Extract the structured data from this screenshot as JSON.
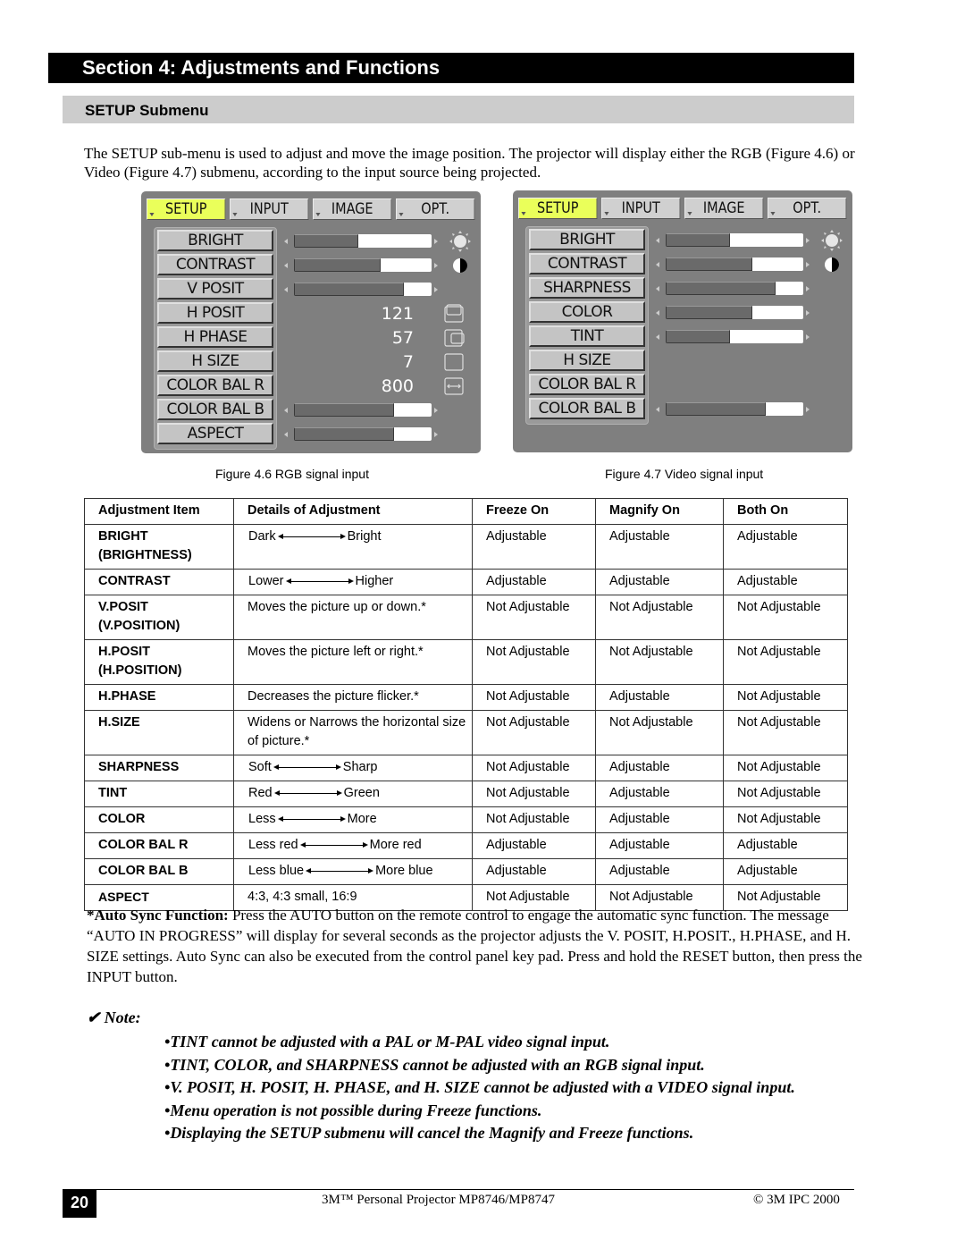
{
  "header": {
    "section_title": "Section 4: Adjustments and Functions",
    "subsection_title": "SETUP Submenu"
  },
  "intro": "The SETUP sub-menu is used to adjust and move the image position. The projector will display either the RGB (Figure 4.6) or Video (Figure 4.7) submenu, according to the input source being projected.",
  "osd_rgb": {
    "caption": "Figure 4.6 RGB signal input",
    "tabs": [
      "SETUP",
      "INPUT",
      "IMAGE",
      "OPT."
    ],
    "active_tab": "SETUP",
    "items": [
      {
        "label": "BRIGHT",
        "type": "slider",
        "level_percent": 47,
        "icon": "sun-icon"
      },
      {
        "label": "CONTRAST",
        "type": "slider",
        "level_percent": 63,
        "icon": "contrast-icon"
      },
      {
        "label": "V POSIT",
        "type": "slider",
        "level_percent": 80,
        "icon": ""
      },
      {
        "label": "H POSIT",
        "type": "value",
        "value": "121",
        "icon": "h-position-icon"
      },
      {
        "label": "H PHASE",
        "type": "value",
        "value": "57",
        "icon": "h-phase-icon"
      },
      {
        "label": "H SIZE",
        "type": "value",
        "value": "7",
        "icon": "h-size-icon"
      },
      {
        "label": "COLOR BAL R",
        "type": "value",
        "value": "800",
        "icon": "width-arrows-icon"
      },
      {
        "label": "COLOR BAL B",
        "type": "slider",
        "level_percent": 73,
        "icon": ""
      },
      {
        "label": "ASPECT",
        "type": "slider",
        "level_percent": 73,
        "icon": ""
      }
    ]
  },
  "osd_video": {
    "caption": "Figure 4.7 Video signal input",
    "tabs": [
      "SETUP",
      "INPUT",
      "IMAGE",
      "OPT."
    ],
    "active_tab": "SETUP",
    "items": [
      {
        "label": "BRIGHT",
        "type": "slider",
        "level_percent": 47,
        "icon": "sun-icon"
      },
      {
        "label": "CONTRAST",
        "type": "slider",
        "level_percent": 63,
        "icon": "contrast-icon"
      },
      {
        "label": "SHARPNESS",
        "type": "slider",
        "level_percent": 80,
        "icon": ""
      },
      {
        "label": "COLOR",
        "type": "slider",
        "level_percent": 63,
        "icon": ""
      },
      {
        "label": "TINT",
        "type": "slider",
        "level_percent": 47,
        "icon": ""
      },
      {
        "label": "H SIZE",
        "type": "none",
        "icon": ""
      },
      {
        "label": "COLOR BAL R",
        "type": "none",
        "icon": ""
      },
      {
        "label": "COLOR BAL B",
        "type": "slider",
        "level_percent": 73,
        "icon": ""
      }
    ]
  },
  "table": {
    "headers": [
      "Adjustment Item",
      "Details of Adjustment",
      "Freeze On",
      "Magnify On",
      "Both On"
    ],
    "rows": [
      {
        "item": "BRIGHT",
        "item2": "(BRIGHTNESS)",
        "detail_type": "range",
        "from": "Dark",
        "to": "Bright",
        "freeze": "Adjustable",
        "magnify": "Adjustable",
        "both": "Adjustable"
      },
      {
        "item": "CONTRAST",
        "item2": "",
        "detail_type": "range",
        "from": "Lower",
        "to": "Higher",
        "freeze": "Adjustable",
        "magnify": "Adjustable",
        "both": "Adjustable"
      },
      {
        "item": "V.POSIT",
        "item2": "(V.POSITION)",
        "detail_type": "text",
        "detail": "Moves the picture up or down.*",
        "freeze": "Not Adjustable",
        "magnify": "Not Adjustable",
        "both": "Not Adjustable"
      },
      {
        "item": "H.POSIT",
        "item2": "(H.POSITION)",
        "detail_type": "text",
        "detail": "Moves the picture left or right.*",
        "freeze": "Not Adjustable",
        "magnify": "Not Adjustable",
        "both": "Not Adjustable"
      },
      {
        "item": "H.PHASE",
        "item2": "",
        "detail_type": "text",
        "detail": "Decreases the picture flicker.*",
        "freeze": "Not Adjustable",
        "magnify": "Adjustable",
        "both": "Not Adjustable"
      },
      {
        "item": "H.SIZE",
        "item2": "",
        "detail_type": "text",
        "detail": "Widens or Narrows the horizontal size of picture.*",
        "freeze": "Not Adjustable",
        "magnify": "Not Adjustable",
        "both": "Not Adjustable"
      },
      {
        "item": "SHARPNESS",
        "item2": "",
        "detail_type": "range",
        "from": "Soft",
        "to": "Sharp",
        "freeze": "Not Adjustable",
        "magnify": "Adjustable",
        "both": "Not Adjustable"
      },
      {
        "item": "TINT",
        "item2": "",
        "detail_type": "range",
        "from": "Red",
        "to": "Green",
        "freeze": "Not Adjustable",
        "magnify": "Adjustable",
        "both": "Not Adjustable"
      },
      {
        "item": "COLOR",
        "item2": "",
        "detail_type": "range",
        "from": "Less",
        "to": "More",
        "freeze": "Not Adjustable",
        "magnify": "Adjustable",
        "both": "Not Adjustable"
      },
      {
        "item": "COLOR BAL R",
        "item2": "",
        "detail_type": "range",
        "from": "Less red",
        "to": "More red",
        "freeze": "Adjustable",
        "magnify": "Adjustable",
        "both": "Adjustable"
      },
      {
        "item": "COLOR BAL B",
        "item2": "",
        "detail_type": "range",
        "from": "Less blue",
        "to": "More blue",
        "freeze": "Adjustable",
        "magnify": "Adjustable",
        "both": "Adjustable"
      },
      {
        "item": "ASPECT",
        "item2": "",
        "detail_type": "text",
        "detail": "4:3, 4:3 small, 16:9",
        "freeze": "Not Adjustable",
        "magnify": "Not Adjustable",
        "both": "Not Adjustable"
      }
    ]
  },
  "auto_sync": {
    "label": "*Auto Sync Function:",
    "text": " Press the AUTO button on the remote control to engage the automatic sync function. The message “AUTO IN PROGRESS” will display for several seconds as the projector adjusts the V. POSIT, H.POSIT., H.PHASE, and H. SIZE settings. Auto Sync can also be executed from the control panel key pad. Press and hold the RESET button, then press the INPUT button."
  },
  "note": {
    "icon": "checkmark-icon",
    "heading": "Note:",
    "items": [
      "TINT cannot be adjusted with a PAL or M-PAL video signal input.",
      "TINT, COLOR, and SHARPNESS cannot be adjusted with an RGB signal input.",
      "V. POSIT, H. POSIT, H. PHASE, and H. SIZE cannot be adjusted with a VIDEO signal input.",
      "Menu operation is not possible during Freeze functions.",
      "Displaying the SETUP submenu will cancel the Magnify and Freeze functions."
    ]
  },
  "footer": {
    "page_number": "20",
    "product": "3M™ Personal Projector MP8746/MP8747",
    "copyright": "© 3M IPC 2000"
  },
  "colors": {
    "osd_background": "#7f7f7f",
    "active_tab": "#eaff5a",
    "section_bar": "#000000",
    "subsection_bar": "#cccccc"
  }
}
